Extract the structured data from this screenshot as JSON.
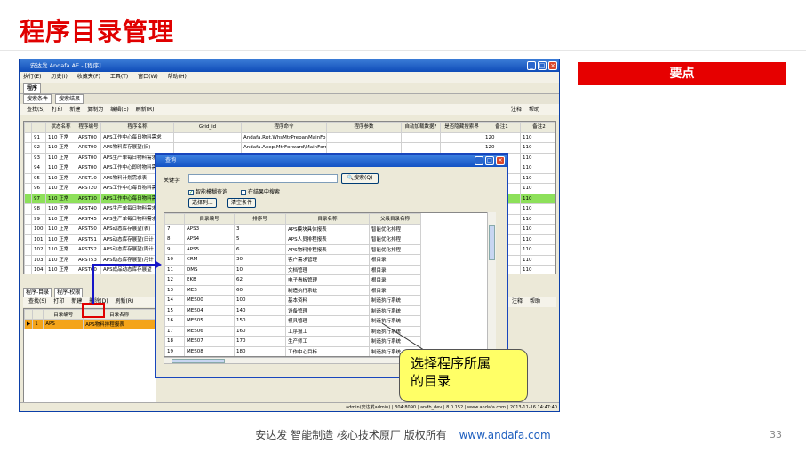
{
  "slide_title": "程序目录管理",
  "keypoint": "要点",
  "footer": {
    "text": "安达发  智能制造 核心技术原厂  版权所有",
    "link": "www.andafa.com"
  },
  "page_number": "33",
  "callout": {
    "line1": "选择程序所属",
    "line2": "的目录"
  },
  "app": {
    "window_title": "安达发 Andafa AE - [程序]",
    "menu": [
      "执行(E)",
      "历史(I)",
      "收藏夹(F)",
      "工具(T)",
      "窗口(W)",
      "帮助(H)"
    ],
    "module_tab": "程序",
    "sub_tabs": [
      "搜索条件",
      "搜索结果"
    ],
    "toolbar": [
      "查找(S)",
      "打印",
      "新建",
      "复制为",
      "编辑(E)",
      "刷新(R)"
    ],
    "toolbar_right": [
      "注释",
      "帮助"
    ],
    "grid_headers": [
      "",
      "",
      "状态名称",
      "程序编号",
      "程序名称",
      "Grid_id",
      "程序命令",
      "程序参数",
      "自动加载数据?",
      "是否隐藏搜索界",
      "备注1",
      "备注2"
    ],
    "grid_rows": [
      {
        "n": "91",
        "status": "110 正常",
        "code": "APST00",
        "name": "APS工作中心每日物料需求",
        "cmd": "Andafa.Rpt.WhsMtrPrepar\\MainForm",
        "r1": "120",
        "r2": "110"
      },
      {
        "n": "92",
        "status": "110 正常",
        "code": "APST00",
        "name": "APS物料库存展望(旧)",
        "cmd": "Andafa.Aeep.MtrForward\\MainForm",
        "r1": "120",
        "r2": "110"
      },
      {
        "n": "93",
        "status": "110 正常",
        "code": "APST00",
        "name": "APS生产单每日物料需求",
        "cmd": "",
        "r1": "",
        "r2": "110"
      },
      {
        "n": "94",
        "status": "110 正常",
        "code": "APST00",
        "name": "APS工作中心即时物料需",
        "cmd": "",
        "r1": "",
        "r2": "110"
      },
      {
        "n": "95",
        "status": "110 正常",
        "code": "APST10",
        "name": "APS物料计划需求表",
        "cmd": "",
        "r1": "",
        "r2": "110"
      },
      {
        "n": "96",
        "status": "110 正常",
        "code": "APST20",
        "name": "APS工作中心每日物料需",
        "cmd": "",
        "r1": "",
        "r2": "110"
      },
      {
        "n": "97",
        "status": "110 正常",
        "code": "APST30",
        "name": "APS工作中心每日物料需",
        "cmd": "",
        "r1": "",
        "r2": "110"
      },
      {
        "n": "98",
        "status": "110 正常",
        "code": "APST40",
        "name": "APS生产单每日物料需求",
        "cmd": "",
        "r1": "",
        "r2": "110"
      },
      {
        "n": "99",
        "status": "110 正常",
        "code": "APST45",
        "name": "APS生产单每日物料需求",
        "cmd": "",
        "r1": "",
        "r2": "110"
      },
      {
        "n": "100",
        "status": "110 正常",
        "code": "APST50",
        "name": "APS动态库存展望(表)",
        "cmd": "",
        "r1": "",
        "r2": "110"
      },
      {
        "n": "101",
        "status": "110 正常",
        "code": "APST51",
        "name": "APS动态库存展望(日计",
        "cmd": "",
        "r1": "",
        "r2": "110"
      },
      {
        "n": "102",
        "status": "110 正常",
        "code": "APST52",
        "name": "APS动态库存展望(周计",
        "cmd": "",
        "r1": "",
        "r2": "110"
      },
      {
        "n": "103",
        "status": "110 正常",
        "code": "APST53",
        "name": "APS动态库存展望(月计",
        "cmd": "",
        "r1": "",
        "r2": "110"
      },
      {
        "n": "104",
        "status": "110 正常",
        "code": "APST60",
        "name": "APS成品动态库存展望",
        "cmd": "",
        "r1": "",
        "r2": "110"
      }
    ],
    "lower_tabs": [
      "程序-目录",
      "程序-权限"
    ],
    "lower_toolbar": [
      "查找(S)",
      "打印",
      "新建",
      "删除(D)",
      "刷新(R)"
    ],
    "lower_toolbar_right": [
      "注释",
      "帮助"
    ],
    "lower_headers": [
      "",
      "",
      "目录编号",
      "目录名称"
    ],
    "lower_row": {
      "n": "1",
      "code": "APS",
      "name": "APS物料排程报表"
    },
    "statusbar": "admin(安达发admin) | 304:8090 | andb_dev | 8.0.152 | www.andafa.com | 2013-11-16 14:47:40"
  },
  "dialog": {
    "title": "查询",
    "keyword_label": "关键字",
    "search_button": "搜索(Q)",
    "checkbox1": "智能模糊查询",
    "checkbox2": "在结果中搜索",
    "buttons": [
      "选择列...",
      "清空条件"
    ],
    "headers": [
      "",
      "目录编号",
      "排序号",
      "目录名称",
      "父级目录名称"
    ],
    "rows": [
      {
        "n": "7",
        "code": "APS3",
        "sort": "3",
        "name": "APS模块具体报表",
        "parent": "智能优化排程"
      },
      {
        "n": "8",
        "code": "APS4",
        "sort": "5",
        "name": "APS人员排程报表",
        "parent": "智能优化排程"
      },
      {
        "n": "9",
        "code": "APS5",
        "sort": "6",
        "name": "APS物料排程报表",
        "parent": "智能优化排程"
      },
      {
        "n": "10",
        "code": "CRM",
        "sort": "30",
        "name": "客户需求管理",
        "parent": "根目录"
      },
      {
        "n": "11",
        "code": "DMS",
        "sort": "10",
        "name": "文档管理",
        "parent": "根目录"
      },
      {
        "n": "12",
        "code": "EKB",
        "sort": "62",
        "name": "电子看板管理",
        "parent": "根目录"
      },
      {
        "n": "13",
        "code": "MES",
        "sort": "60",
        "name": "制造执行系统",
        "parent": "根目录"
      },
      {
        "n": "14",
        "code": "MES00",
        "sort": "100",
        "name": "基本资料",
        "parent": "制造执行系统"
      },
      {
        "n": "15",
        "code": "MES04",
        "sort": "140",
        "name": "设备管理",
        "parent": "制造执行系统"
      },
      {
        "n": "16",
        "code": "MES05",
        "sort": "150",
        "name": "模具管理",
        "parent": "制造执行系统"
      },
      {
        "n": "17",
        "code": "MES06",
        "sort": "160",
        "name": "工序报工",
        "parent": "制造执行系统"
      },
      {
        "n": "18",
        "code": "MES07",
        "sort": "170",
        "name": "生产师工",
        "parent": "制造执行系统"
      },
      {
        "n": "19",
        "code": "MES08",
        "sort": "180",
        "name": "工作中心目标",
        "parent": "制造执行系统"
      }
    ]
  }
}
